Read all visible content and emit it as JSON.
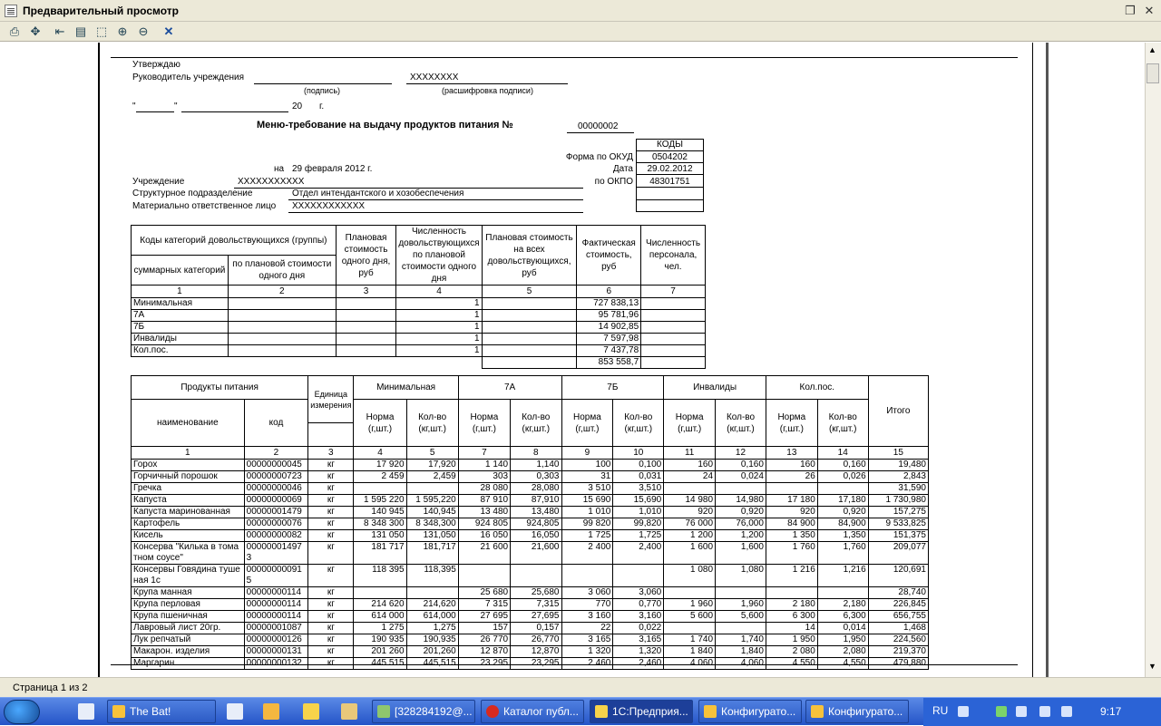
{
  "window": {
    "title": "Предварительный просмотр"
  },
  "status": {
    "page": "Страница 1 из 2"
  },
  "doc": {
    "approve": "Утверждаю",
    "head_label": "Руководитель учреждения",
    "head_name": "ХХХХХХХХ",
    "sig_caption": "(подпись)",
    "decode_caption": "(расшифровка подписи)",
    "date_quote1": "\"",
    "date_quote2": "\"",
    "year_prefix": "20",
    "year_suffix": "г.",
    "title": "Меню-требование на выдачу продуктов питания №",
    "number": "00000002",
    "codes_header": "КОДЫ",
    "okud_label": "Форма по ОКУД",
    "okud_value": "0504202",
    "date_label": "Дата",
    "date_value": "29.02.2012",
    "okpo_label": "по ОКПО",
    "okpo_value": "48301751",
    "on_label": "на",
    "on_date": "29 февраля 2012 г.",
    "inst_label": "Учреждение",
    "inst_value": "ХХХХХХХХХХХ",
    "dept_label": "Структурное подразделение",
    "dept_value": "Отдел интендантского и хозобеспечения",
    "mol_label": "Материально ответственное лицо",
    "mol_value": "ХХХХХХХХХХХХ"
  },
  "cat_table": {
    "h_group": "Коды категорий довольствующихся (группы)",
    "h_sum": "суммарных категорий",
    "h_plan_one": "по плановой стоимости одного дня",
    "h_plan_cost": "Плановая стоимость одного дня, руб",
    "h_count": "Численность довольствующихся по плановой стоимости одного дня",
    "h_plan_all": "Плановая стоимость на всех довольствующихся, руб",
    "h_fact": "Фактическая стоимость, руб",
    "h_staff": "Численность персонала, чел.",
    "nums": [
      "1",
      "2",
      "3",
      "4",
      "5",
      "6",
      "7"
    ],
    "rows": [
      {
        "name": "Минимальная",
        "count": "1",
        "fact": "727 838,13"
      },
      {
        "name": "7А",
        "count": "1",
        "fact": "95 781,96"
      },
      {
        "name": "7Б",
        "count": "1",
        "fact": "14 902,85"
      },
      {
        "name": "Инвалиды",
        "count": "1",
        "fact": "7 597,98"
      },
      {
        "name": "Кол.пос.",
        "count": "1",
        "fact": "7 437,78"
      }
    ],
    "total": "853 558,7"
  },
  "prod_table": {
    "h_products": "Продукты питания",
    "h_name": "наименование",
    "h_code": "код",
    "h_unit": "Единица измерения",
    "groups": [
      "Минимальная",
      "7А",
      "7Б",
      "Инвалиды",
      "Кол.пос."
    ],
    "h_norm": "Норма (г,шт.)",
    "h_qty": "Кол-во (кг,шт.)",
    "h_total": "Итого",
    "nums": [
      "1",
      "2",
      "3",
      "4",
      "5",
      "7",
      "8",
      "9",
      "10",
      "11",
      "12",
      "13",
      "14",
      "15"
    ],
    "rows": [
      [
        "Горох",
        "00000000045",
        "кг",
        "17 920",
        "17,920",
        "1 140",
        "1,140",
        "100",
        "0,100",
        "160",
        "0,160",
        "160",
        "0,160",
        "19,480"
      ],
      [
        "Горчичный порошок",
        "00000000723",
        "кг",
        "2 459",
        "2,459",
        "303",
        "0,303",
        "31",
        "0,031",
        "24",
        "0,024",
        "26",
        "0,026",
        "2,843"
      ],
      [
        "Гречка",
        "00000000046",
        "кг",
        "",
        "",
        "28 080",
        "28,080",
        "3 510",
        "3,510",
        "",
        "",
        "",
        "",
        "31,590"
      ],
      [
        "Капуста",
        "00000000069",
        "кг",
        "1 595 220",
        "1 595,220",
        "87 910",
        "87,910",
        "15 690",
        "15,690",
        "14 980",
        "14,980",
        "17 180",
        "17,180",
        "1 730,980"
      ],
      [
        "Капуста маринованная",
        "00000001479",
        "кг",
        "140 945",
        "140,945",
        "13 480",
        "13,480",
        "1 010",
        "1,010",
        "920",
        "0,920",
        "920",
        "0,920",
        "157,275"
      ],
      [
        "Картофель",
        "00000000076",
        "кг",
        "8 348 300",
        "8 348,300",
        "924 805",
        "924,805",
        "99 820",
        "99,820",
        "76 000",
        "76,000",
        "84 900",
        "84,900",
        "9 533,825"
      ],
      [
        "Кисель",
        "00000000082",
        "кг",
        "131 050",
        "131,050",
        "16 050",
        "16,050",
        "1 725",
        "1,725",
        "1 200",
        "1,200",
        "1 350",
        "1,350",
        "151,375"
      ],
      [
        "Консерва \"Килька в томатном соусе\"",
        "000000014973",
        "кг",
        "181 717",
        "181,717",
        "21 600",
        "21,600",
        "2 400",
        "2,400",
        "1 600",
        "1,600",
        "1 760",
        "1,760",
        "209,077"
      ],
      [
        "Консервы Говядина тушеная 1с",
        "000000000915",
        "кг",
        "118 395",
        "118,395",
        "",
        "",
        "",
        "",
        "1 080",
        "1,080",
        "1 216",
        "1,216",
        "120,691"
      ],
      [
        "Крупа манная",
        "00000000114",
        "кг",
        "",
        "",
        "25 680",
        "25,680",
        "3 060",
        "3,060",
        "",
        "",
        "",
        "",
        "28,740"
      ],
      [
        "Крупа перловая",
        "00000000114",
        "кг",
        "214 620",
        "214,620",
        "7 315",
        "7,315",
        "770",
        "0,770",
        "1 960",
        "1,960",
        "2 180",
        "2,180",
        "226,845"
      ],
      [
        "Крупа пшеничная",
        "00000000114",
        "кг",
        "614 000",
        "614,000",
        "27 695",
        "27,695",
        "3 160",
        "3,160",
        "5 600",
        "5,600",
        "6 300",
        "6,300",
        "656,755"
      ],
      [
        "Лавровый лист 20гр.",
        "00000001087",
        "кг",
        "1 275",
        "1,275",
        "157",
        "0,157",
        "22",
        "0,022",
        "",
        "",
        "14",
        "0,014",
        "1,468"
      ],
      [
        "Лук репчатый",
        "00000000126",
        "кг",
        "190 935",
        "190,935",
        "26 770",
        "26,770",
        "3 165",
        "3,165",
        "1 740",
        "1,740",
        "1 950",
        "1,950",
        "224,560"
      ],
      [
        "Макарон. изделия",
        "00000000131",
        "кг",
        "201 260",
        "201,260",
        "12 870",
        "12,870",
        "1 320",
        "1,320",
        "1 840",
        "1,840",
        "2 080",
        "2,080",
        "219,370"
      ],
      [
        "Маргарин",
        "00000000132",
        "кг",
        "445 515",
        "445,515",
        "23 295",
        "23,295",
        "2 460",
        "2,460",
        "4 060",
        "4,060",
        "4 550",
        "4,550",
        "479,880"
      ]
    ]
  },
  "taskbar": {
    "items": [
      "The Bat!",
      "[328284192@...",
      "Каталог публ...",
      "1С:Предприя...",
      "Конфигурато...",
      "Конфигурато..."
    ],
    "lang": "RU",
    "clock": "9:17"
  }
}
